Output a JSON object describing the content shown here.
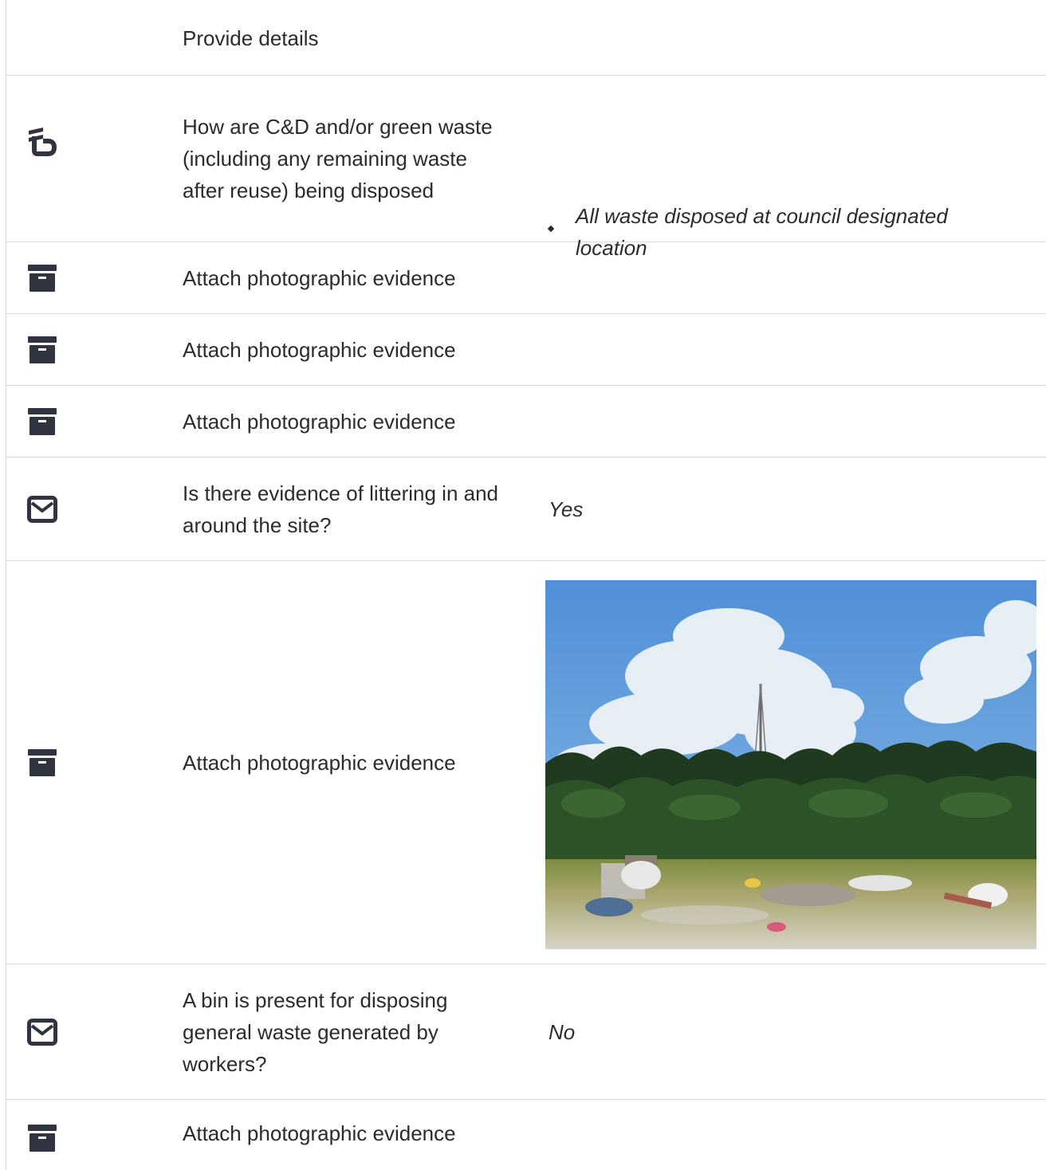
{
  "rows": [
    {
      "type": "header",
      "question": "Provide details"
    },
    {
      "type": "list",
      "icon": "tenge-icon",
      "question": "How are C&D and/or green waste (including any remaining waste after reuse) being disposed",
      "answer_items": [
        "All waste disposed at council designated location"
      ]
    },
    {
      "type": "photo",
      "icon": "archive-icon",
      "question": "Attach photographic evidence"
    },
    {
      "type": "photo",
      "icon": "archive-icon",
      "question": "Attach photographic evidence"
    },
    {
      "type": "photo",
      "icon": "archive-icon",
      "question": "Attach photographic evidence"
    },
    {
      "type": "choice",
      "icon": "envelope-icon",
      "question": "Is there evidence of littering in and around the site?",
      "answer": "Yes"
    },
    {
      "type": "photo",
      "icon": "archive-icon",
      "question": "Attach photographic evidence",
      "photo": "site-photo-litter"
    },
    {
      "type": "choice",
      "icon": "envelope-icon",
      "question": "A bin is present for disposing general waste generated by workers?",
      "answer": "No"
    },
    {
      "type": "photo",
      "icon": "archive-icon",
      "question": "Attach photographic evidence"
    }
  ],
  "colors": {
    "icon": "#2f3440",
    "border": "#d9d9d9",
    "text": "#2b2b2b"
  }
}
